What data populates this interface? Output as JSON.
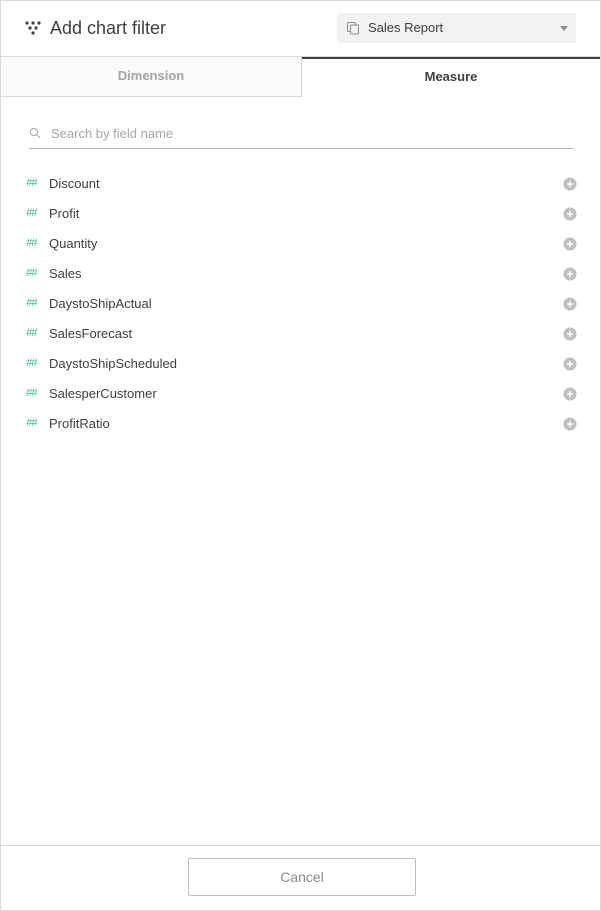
{
  "header": {
    "title": "Add chart filter",
    "source_select": {
      "selected": "Sales Report",
      "icon": "database-icon"
    }
  },
  "tabs": [
    {
      "label": "Dimension",
      "active": false
    },
    {
      "label": "Measure",
      "active": true
    }
  ],
  "search": {
    "placeholder": "Search by field name",
    "value": ""
  },
  "fields": [
    {
      "type": "##",
      "name": "Discount"
    },
    {
      "type": "##",
      "name": "Profit"
    },
    {
      "type": "##",
      "name": "Quantity"
    },
    {
      "type": "##",
      "name": "Sales"
    },
    {
      "type": "##",
      "name": "DaystoShipActual"
    },
    {
      "type": "##",
      "name": "SalesForecast"
    },
    {
      "type": "##",
      "name": "DaystoShipScheduled"
    },
    {
      "type": "##",
      "name": "SalesperCustomer"
    },
    {
      "type": "##",
      "name": "ProfitRatio"
    }
  ],
  "footer": {
    "cancel_label": "Cancel"
  },
  "colors": {
    "measure_accent": "#3ab88a",
    "text": "#404040",
    "muted": "#a6a6a6",
    "border": "#d9d9d9"
  }
}
